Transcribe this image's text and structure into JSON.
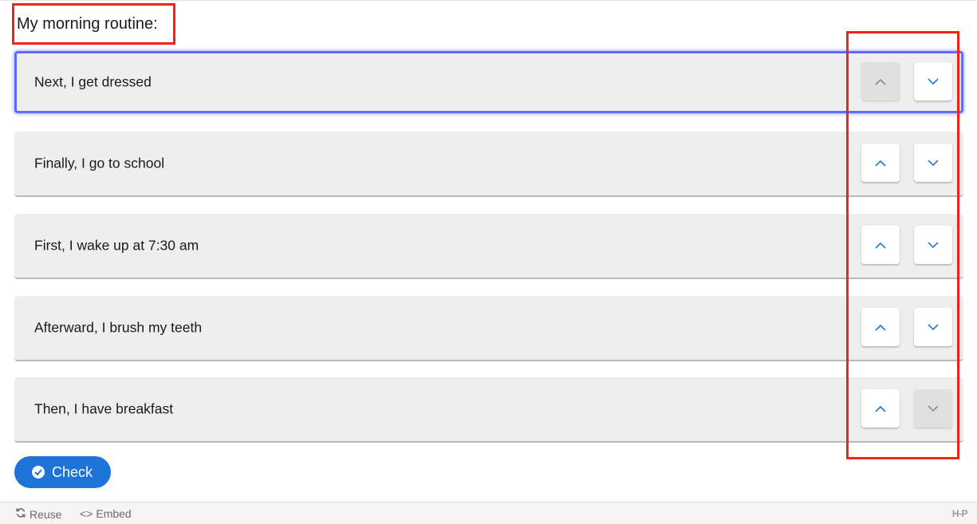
{
  "question": "My morning routine:",
  "items": [
    {
      "label": "Next, I get dressed",
      "up_disabled": true,
      "down_disabled": false,
      "focused": true
    },
    {
      "label": "Finally, I go to school",
      "up_disabled": false,
      "down_disabled": false,
      "focused": false
    },
    {
      "label": "First, I wake up at 7:30 am",
      "up_disabled": false,
      "down_disabled": false,
      "focused": false
    },
    {
      "label": "Afterward, I brush my teeth",
      "up_disabled": false,
      "down_disabled": false,
      "focused": false
    },
    {
      "label": "Then, I have breakfast",
      "up_disabled": false,
      "down_disabled": true,
      "focused": false
    }
  ],
  "check_button": "Check",
  "footer": {
    "reuse": "Reuse",
    "embed": "Embed",
    "logo": "H-P"
  },
  "colors": {
    "accent": "#1e74d6",
    "arrow": "#1e74d6",
    "arrow_disabled": "#8a8a8a",
    "focus_outline": "#5b6cff",
    "annotation": "#f2231a"
  }
}
